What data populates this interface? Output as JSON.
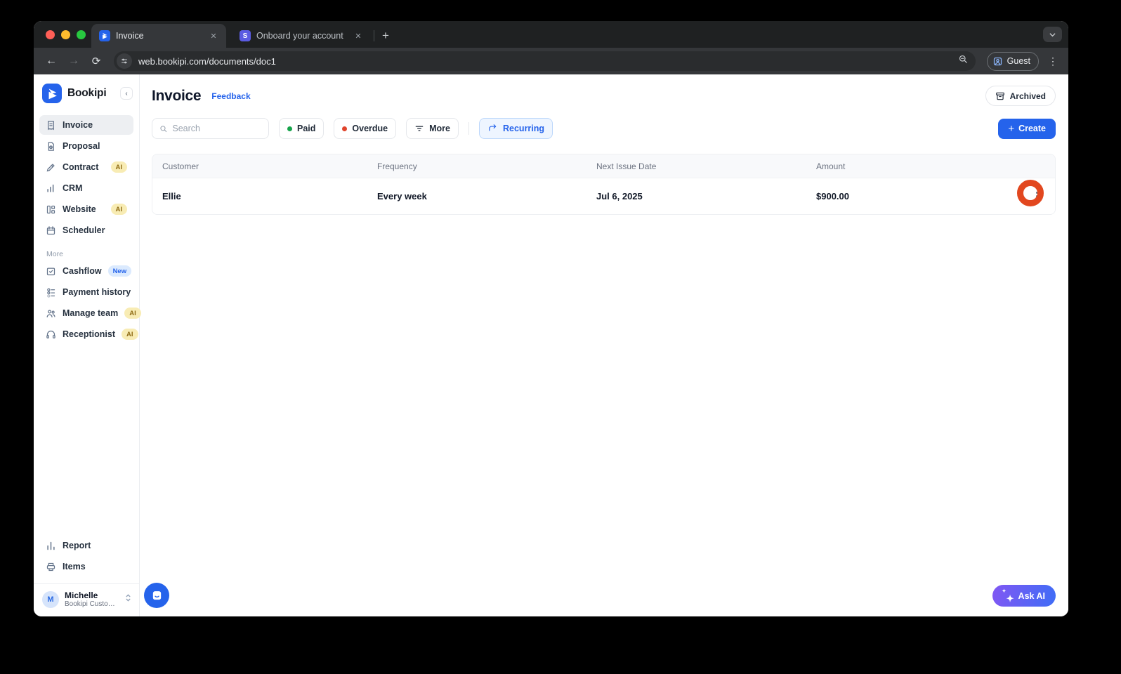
{
  "browser": {
    "tabs": [
      {
        "title": "Invoice"
      },
      {
        "title": "Onboard your account"
      }
    ],
    "url": "web.bookipi.com/documents/doc1",
    "guest_label": "Guest"
  },
  "sidebar": {
    "brand": "Bookipi",
    "items": [
      {
        "label": "Invoice",
        "badge": ""
      },
      {
        "label": "Proposal",
        "badge": ""
      },
      {
        "label": "Contract",
        "badge": "AI"
      },
      {
        "label": "CRM",
        "badge": ""
      },
      {
        "label": "Website",
        "badge": "AI"
      },
      {
        "label": "Scheduler",
        "badge": ""
      }
    ],
    "more_label": "More",
    "more_items": [
      {
        "label": "Cashflow",
        "badge": "New"
      },
      {
        "label": "Payment history",
        "badge": ""
      },
      {
        "label": "Manage team",
        "badge": "AI"
      },
      {
        "label": "Receptionist",
        "badge": "AI"
      }
    ],
    "bottom_items": [
      {
        "label": "Report"
      },
      {
        "label": "Items"
      }
    ],
    "user": {
      "initial": "M",
      "name": "Michelle",
      "subtitle": "Bookipi Customer S..."
    }
  },
  "header": {
    "title": "Invoice",
    "feedback_link": "Feedback",
    "archived_button": "Archived"
  },
  "filters": {
    "search_placeholder": "Search",
    "paid": "Paid",
    "overdue": "Overdue",
    "more": "More",
    "recurring": "Recurring"
  },
  "actions": {
    "create": "Create",
    "ask_ai": "Ask AI"
  },
  "table": {
    "columns": [
      "Customer",
      "Frequency",
      "Next Issue Date",
      "Amount"
    ],
    "rows": [
      {
        "customer": "Ellie",
        "frequency": "Every week",
        "next_issue_date": "Jul 6, 2025",
        "amount": "$900.00"
      }
    ]
  },
  "colors": {
    "accent_blue": "#2563eb",
    "annotation_ring": "#e2471f",
    "paid_dot": "#16a34a",
    "overdue_dot": "#e0442c",
    "ai_badge_bg": "#f8ecb4",
    "new_badge_bg": "#dbeafe",
    "ask_ai_gradient_start": "#8157f3",
    "ask_ai_gradient_end": "#3f6df6"
  }
}
